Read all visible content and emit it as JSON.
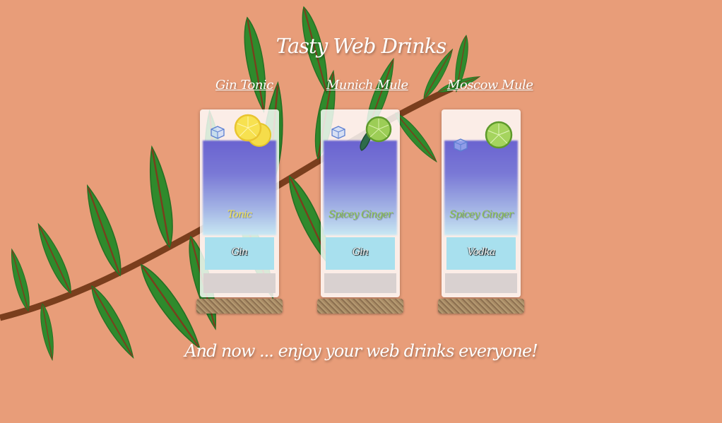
{
  "page": {
    "title": "Tasty Web Drinks",
    "footer": "And now ... enjoy your web drinks everyone!"
  },
  "colors": {
    "background": "#e89d79",
    "leaf": "#2f8a2c",
    "stem": "#7a3e1d",
    "liquid_top": "#6a63d0",
    "label_tonic": "#f2e34a",
    "label_ginger": "#8bc34a"
  },
  "drinks": [
    {
      "name": "Gin Tonic",
      "top_label": "Tonic",
      "bottom_label": "Gin",
      "garnish": "lemon-slice-icon"
    },
    {
      "name": "Munich Mule",
      "top_label": "Spicey Ginger",
      "bottom_label": "Gin",
      "garnish": "cucumber-lime-icon"
    },
    {
      "name": "Moscow Mule",
      "top_label": "Spicey Ginger",
      "bottom_label": "Vodka",
      "garnish": "lime-slice-icon"
    }
  ]
}
